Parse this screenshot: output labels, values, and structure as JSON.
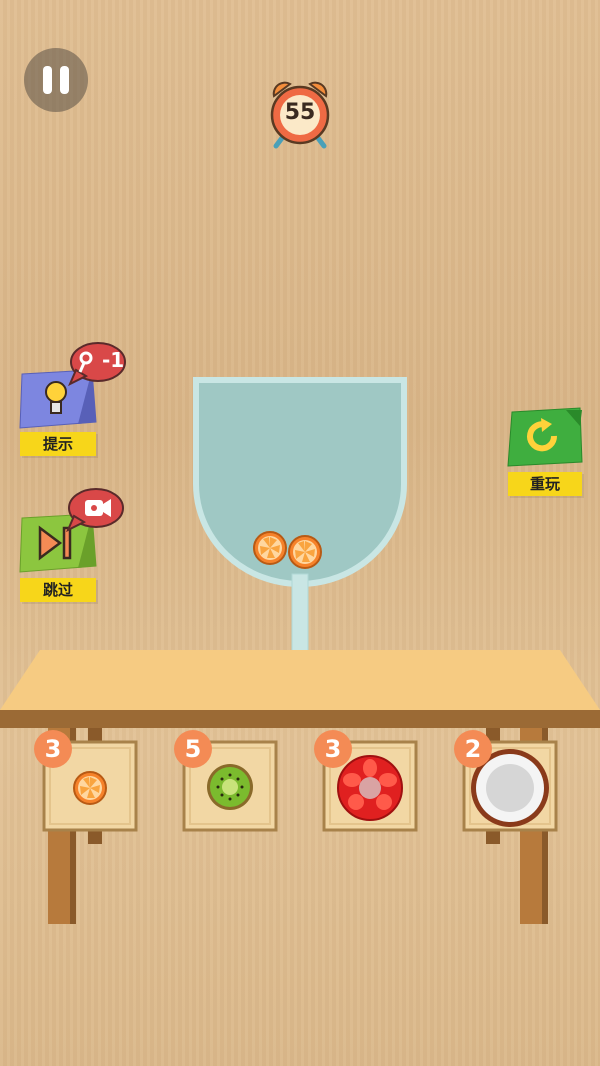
{
  "hud": {
    "pause_icon": "pause-icon",
    "timer_value": "55",
    "timer_icon": "alarm-clock-icon"
  },
  "side_buttons": {
    "hint": {
      "label": "提示",
      "badge": "-1",
      "icon": "lightbulb-icon",
      "badge_icon": "key-icon"
    },
    "skip": {
      "label": "跳过",
      "icon": "skip-forward-icon",
      "badge_icon": "video-icon"
    },
    "replay": {
      "label": "重玩",
      "icon": "refresh-icon"
    }
  },
  "fruit_cards": [
    {
      "fruit": "orange-slice",
      "count": "3"
    },
    {
      "fruit": "kiwi-slice",
      "count": "5"
    },
    {
      "fruit": "tomato-slice",
      "count": "3"
    },
    {
      "fruit": "coconut-half",
      "count": "2"
    }
  ],
  "glass_contents": [
    "orange-slice",
    "orange-slice"
  ],
  "colors": {
    "label_yellow": "#f7d61a",
    "hint_blue": "#7d86e0",
    "skip_green": "#8cc63f",
    "replay_green": "#3fae3f",
    "badge_red": "#d94848",
    "count_orange": "#f48b55",
    "table_top": "#f6cb82",
    "glass_water": "#9fc8c4"
  }
}
